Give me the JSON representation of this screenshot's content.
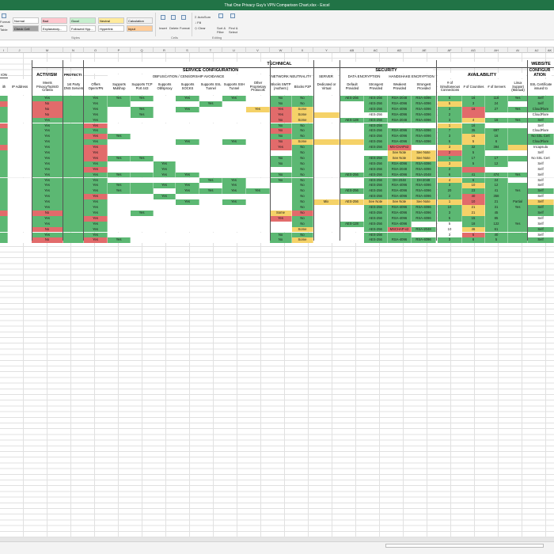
{
  "window": {
    "title": "That One Privacy Guy's VPN Comparison Chart.xlsx - Excel"
  },
  "ribbon": {
    "styles": [
      {
        "label": "Normal",
        "color": "#ffffff"
      },
      {
        "label": "Bad",
        "color": "#ffc7ce"
      },
      {
        "label": "Good",
        "color": "#c6efce"
      },
      {
        "label": "Neutral",
        "color": "#ffeb9c"
      },
      {
        "label": "Calculation",
        "color": "#f2f2f2"
      },
      {
        "label": "Check Cell",
        "color": "#a5a5a5"
      },
      {
        "label": "Explanatory...",
        "color": "#ffffff"
      },
      {
        "label": "Followed Hyp...",
        "color": "#ffffff"
      },
      {
        "label": "Hyperlink",
        "color": "#ffffff"
      },
      {
        "label": "Input",
        "color": "#ffcc99"
      }
    ],
    "format_as_table": "Format as Table",
    "group_styles": "Styles",
    "group_cells": "Cells",
    "group_editing": "Editing",
    "insert": "Insert",
    "delete": "Delete",
    "format": "Format",
    "autosum": "AutoSum",
    "fill": "Fill",
    "clear": "Clear",
    "sort_filter": "Sort & Filter",
    "find_select": "Find & Select"
  },
  "columns": [
    "I",
    "J",
    "M",
    "N",
    "O",
    "P",
    "Q",
    "R",
    "S",
    "T",
    "U",
    "V",
    "W",
    "X",
    "Y",
    "AB",
    "AC",
    "AD",
    "AE",
    "AF",
    "AG",
    "AH",
    "AI",
    "AJ",
    "AK"
  ],
  "sections": {
    "technical": "TECHNICAL",
    "website": "WEBSITE",
    "activism": "ACTIVISM",
    "protection": "PROTECTI",
    "service_config": "SERVICE CONFIGURATION",
    "security": "SECURITY",
    "availability": "AVAILABILITY",
    "configuration": "CONFIGUR ATION",
    "obfuscation": "OBFUSCATION / CENSORSHIP AVOIDANCE",
    "net_neutrality": "NETWORK NEUTRALITY",
    "server": "SERVER",
    "data_encryption": "DATA ENCRYPTION",
    "handshake_encryption": "HANDSHAKE ENCRYPTION",
    "partial_left": "ION"
  },
  "headers": [
    "ith",
    "IP Address",
    "Meets PrivacyToolsIO Criteria",
    "1st Party DNS Servers",
    "Offers OpenVPN",
    "Supports Multihop",
    "Supports TCP Port 443",
    "Supports Obfsproxy",
    "Supports SOCKS",
    "Supports SSL Tunnel",
    "Supports SSH Tunnel",
    "Other Proprietary Protocols",
    "Blocks SMTP (Authent.)",
    "Blocks P2P",
    "Dedicated or Virtual",
    "Default Provided",
    "Strongest Provided",
    "Weakest Provided",
    "Strongest Provided",
    "# of Simultaneous Connections",
    "# of Countries",
    "# of Servers",
    "Linux Support (Manual)",
    "SSL Certificate issued to"
  ],
  "rows": [
    [
      "",
      "",
      "Yes",
      "",
      "Yes",
      "Yes",
      "Yes",
      "",
      "Yes",
      "",
      "Yes",
      "",
      "No",
      "No",
      "",
      "AES-256",
      "AES-256",
      "RSA-2048",
      "RSA-4096",
      "5",
      "16",
      "118",
      "Yes",
      "Self"
    ],
    [
      "",
      "",
      "No",
      "",
      "Yes",
      "",
      "",
      "",
      "",
      "Yes",
      "",
      "",
      "No",
      "No",
      "",
      "",
      "AES-256",
      "RSA-4096",
      "RSA-4096",
      "5",
      "3",
      "24",
      "",
      "Self"
    ],
    [
      "",
      "",
      "No",
      "",
      "Yes",
      "",
      "Yes",
      "",
      "Yes",
      "",
      "",
      "Yes",
      "Yes",
      "Some",
      "",
      "",
      "AES-256",
      "RSA-4096",
      "RSA-4096",
      "3",
      "16",
      "27",
      "Yes",
      "CloudFlare"
    ],
    [
      "",
      "",
      "No",
      "",
      "Yes",
      "",
      "Yes",
      "",
      "",
      "",
      "",
      "",
      "Yes",
      "Some",
      "",
      "",
      "AES-256",
      "RSA-4096",
      "RSA-4096",
      "2",
      "",
      "",
      "",
      "CloudFlare"
    ],
    [
      "",
      "",
      "Yes",
      "",
      "Yes",
      "",
      "",
      "",
      "",
      "",
      "",
      "",
      "No",
      "Some",
      "",
      "AES-128",
      "AES-256",
      "RSA-2048",
      "RSA-4096",
      "3",
      "4",
      "16",
      "Yes",
      "Self"
    ],
    [
      "",
      "",
      "Yes",
      "",
      "Yes",
      "",
      "",
      "",
      "",
      "",
      "",
      "",
      "No",
      "No",
      "",
      "",
      "AES-256",
      "",
      "",
      "1",
      "16",
      "",
      "",
      "Self"
    ],
    [
      "",
      "",
      "Yes",
      "",
      "Yes",
      "",
      "",
      "",
      "",
      "",
      "",
      "",
      "No",
      "No",
      "",
      "",
      "AES-256",
      "RSA-4096",
      "RSA-4096",
      "7",
      "35",
      "697",
      "",
      "CloudFlare"
    ],
    [
      "",
      "",
      "Yes",
      "",
      "Yes",
      "Yes",
      "",
      "",
      "",
      "",
      "",
      "",
      "No",
      "No",
      "",
      "",
      "AES-256",
      "RSA-4096",
      "RSA-4096",
      "3",
      "16",
      "16",
      "",
      "No SSL Cert"
    ],
    [
      "",
      "",
      "Yes",
      "",
      "Yes",
      "",
      "",
      "",
      "Yes",
      "",
      "Yes",
      "",
      "No",
      "Some",
      "",
      "",
      "AES-256",
      "RSA-4096",
      "RSA-4096",
      "5",
      "5",
      "6",
      "",
      "CloudFlare"
    ],
    [
      "",
      "",
      "Yes",
      "",
      "Yes",
      "",
      "",
      "",
      "",
      "",
      "",
      "",
      "Yes",
      "No",
      "",
      "",
      "AES-256",
      "MS-CHAPv2",
      "",
      "3",
      "32",
      "394",
      "",
      "Incapsula"
    ],
    [
      "",
      "",
      "Yes",
      "",
      "Yes",
      "",
      "",
      "",
      "",
      "",
      "",
      "",
      "",
      "No",
      "",
      "",
      "",
      "See Note",
      "See Note",
      "2",
      "5",
      "",
      "",
      "Self"
    ],
    [
      "",
      "",
      "Yes",
      "",
      "Yes",
      "Yes",
      "Yes",
      "",
      "",
      "",
      "",
      "",
      "No",
      "No",
      "",
      "",
      "AES-256",
      "See Note",
      "See Note",
      "1",
      "17",
      "17",
      "",
      "No SSL Cert"
    ],
    [
      "",
      "",
      "Yes",
      "",
      "Yes",
      "",
      "",
      "Yes",
      "",
      "",
      "",
      "",
      "No",
      "No",
      "",
      "",
      "AES-256",
      "RSA-4096",
      "RSA-4096",
      "3",
      "5",
      "12",
      "",
      "Self"
    ],
    [
      "",
      "",
      "Yes",
      "",
      "Yes",
      "",
      "",
      "Yes",
      "",
      "",
      "",
      "",
      "",
      "No",
      "",
      "",
      "AES-256",
      "RSA-2048",
      "RSA-4096",
      "2",
      "",
      "",
      "",
      "Self"
    ],
    [
      "",
      "",
      "Yes",
      "",
      "Yes",
      "Yes",
      "",
      "Yes",
      "Yes",
      "",
      "",
      "",
      "No",
      "No",
      "",
      "AES-256",
      "AES-256",
      "RSA-4096",
      "RSA-2048",
      "6",
      "41",
      "474",
      "Yes",
      "Self"
    ],
    [
      "",
      "",
      "Yes",
      "",
      "Yes",
      "",
      "",
      "",
      "",
      "Yes",
      "Yes",
      "",
      "No",
      "No",
      "",
      "",
      "AES-256",
      "DH-2048",
      "DH-2048",
      "4",
      "6",
      "24",
      "",
      "Self"
    ],
    [
      "",
      "",
      "Yes",
      "",
      "Yes",
      "Yes",
      "",
      "Yes",
      "Yes",
      "",
      "Yes",
      "",
      "",
      "No",
      "",
      "",
      "AES-256",
      "RSA-4096",
      "RSA-4096",
      "3",
      "10",
      "12",
      "",
      "Self"
    ],
    [
      "",
      "",
      "Yes",
      "",
      "Yes",
      "Yes",
      "",
      "",
      "Yes",
      "Yes",
      "Yes",
      "Yes",
      "",
      "No",
      "",
      "AES-256",
      "AES-256",
      "RSA-4096",
      "RSA-4096",
      "20",
      "23",
      "41",
      "Yes",
      "Self"
    ],
    [
      "",
      "",
      "Yes",
      "",
      "Yes",
      "",
      "",
      "Yes",
      "",
      "",
      "",
      "",
      "",
      "No",
      "",
      "",
      "AES-256",
      "RSA-4096",
      "RSA-4096",
      "2",
      "40",
      "358",
      "",
      "Self"
    ],
    [
      "",
      "",
      "Yes",
      "",
      "Yes",
      "",
      "",
      "",
      "Yes",
      "",
      "Yes",
      "",
      "",
      "No",
      "Mix",
      "AES-256",
      "See Note",
      "See Note",
      "See Note",
      "1",
      "10",
      "21",
      "Partial",
      "Self"
    ],
    [
      "",
      "",
      "Yes",
      "",
      "Yes",
      "",
      "",
      "",
      "",
      "",
      "",
      "",
      "",
      "No",
      "",
      "",
      "AES-256",
      "RSA-4096",
      "RSA-4096",
      "10",
      "21",
      "31",
      "Yes",
      "Self"
    ],
    [
      "",
      "",
      "No",
      "",
      "Yes",
      "",
      "Yes",
      "",
      "",
      "",
      "",
      "",
      "Some",
      "No",
      "",
      "",
      "AES-256",
      "RSA-4096",
      "RSA-4096",
      "3",
      "21",
      "45",
      "",
      "Self"
    ],
    [
      "",
      "",
      "Yes",
      "",
      "Yes",
      "",
      "",
      "",
      "",
      "",
      "",
      "",
      "Yes",
      "No",
      "",
      "",
      "AES-256",
      "RSA-4096",
      "RSA-4096",
      "5",
      "15",
      "85",
      "",
      "Self"
    ],
    [
      "",
      "",
      "Yes",
      "",
      "Yes",
      "",
      "",
      "",
      "",
      "",
      "",
      "",
      "",
      "No",
      "",
      "AES-128",
      "AES-256",
      "RSA-4096",
      "",
      "5",
      "18",
      "122",
      "Yes",
      "Self"
    ],
    [
      "",
      "",
      "No",
      "",
      "Yes",
      "",
      "",
      "",
      "",
      "",
      "",
      "",
      "",
      "Some",
      "",
      "",
      "AES-256",
      "MSCHAP-v2",
      "RSA-2048",
      "10",
      "46",
      "61",
      "",
      "Self"
    ],
    [
      "",
      "",
      "Yes",
      "",
      "Yes",
      "",
      "",
      "",
      "",
      "",
      "",
      "",
      "No",
      "No",
      "",
      "",
      "AES-256",
      "",
      "",
      "3",
      "5",
      "40",
      "",
      "Self"
    ],
    [
      "",
      "",
      "No",
      "",
      "Yes",
      "Yes",
      "",
      "",
      "",
      "",
      "",
      "",
      "No",
      "Some",
      "",
      "",
      "AES-256",
      "RSA-4096",
      "RSA-4096",
      "3",
      "6",
      "5",
      "",
      "Self"
    ]
  ],
  "row_colors": [
    "gwgggggwgwgwggwgggggggggg",
    "rwrgggwwwgwwggwwgggyggwgg",
    "gwrggwgwgwwyrywwggggrgggr",
    "gwrggwgwwwwwryywwgggrwwwr",
    "gwgggwwwwwwwrywgggggygggg",
    "rwggrwwwwwwwggwwgwwygwwwg",
    "gwgggwwwwwwwrgwwgggggggwr",
    "gwggrgwwwwwwggwwggggygggr",
    "gwgggwwwgwgwryyyggggygggr",
    "rwggrwwwwwwwrgwwgrwyggywr",
    "gwggrwwwwwwwwgwwwyyrgwwwg",
    "gwggrggwwwwwggwwgyyggggwr",
    "gwgggwwgwwwwggwwgggyggwwg",
    "gwggrwwgwwwwwgwwggggrwwwg",
    "gwgggggggwwwggwggggggggwg",
    "gwgggwwwwggwggwwgggyggwwg",
    "gwgggggggwgwwgwwggggyggwg",
    "gwgggggwggggwgwgggggggggg",
    "gwggrwwgwwwwwgwwggggrggwg",
    "gwgggwwwgwgwwgyyyyyyrggyg",
    "gwgggwwwwwwwwgwwggggygggg",
    "rwrggwgwwwwwyrwwggggygggg",
    "gwggrwwwwwwwrgwwgggggggwg",
    "gwgggwwwwwwwwgwgggwwgggwg",
    "gwrggwwwwwwwwywwgrgwygggg",
    "gwgggwwwwwwwggwwggwwrggwg",
    "gwrgrgwwwwwwgywwggggggggg"
  ]
}
